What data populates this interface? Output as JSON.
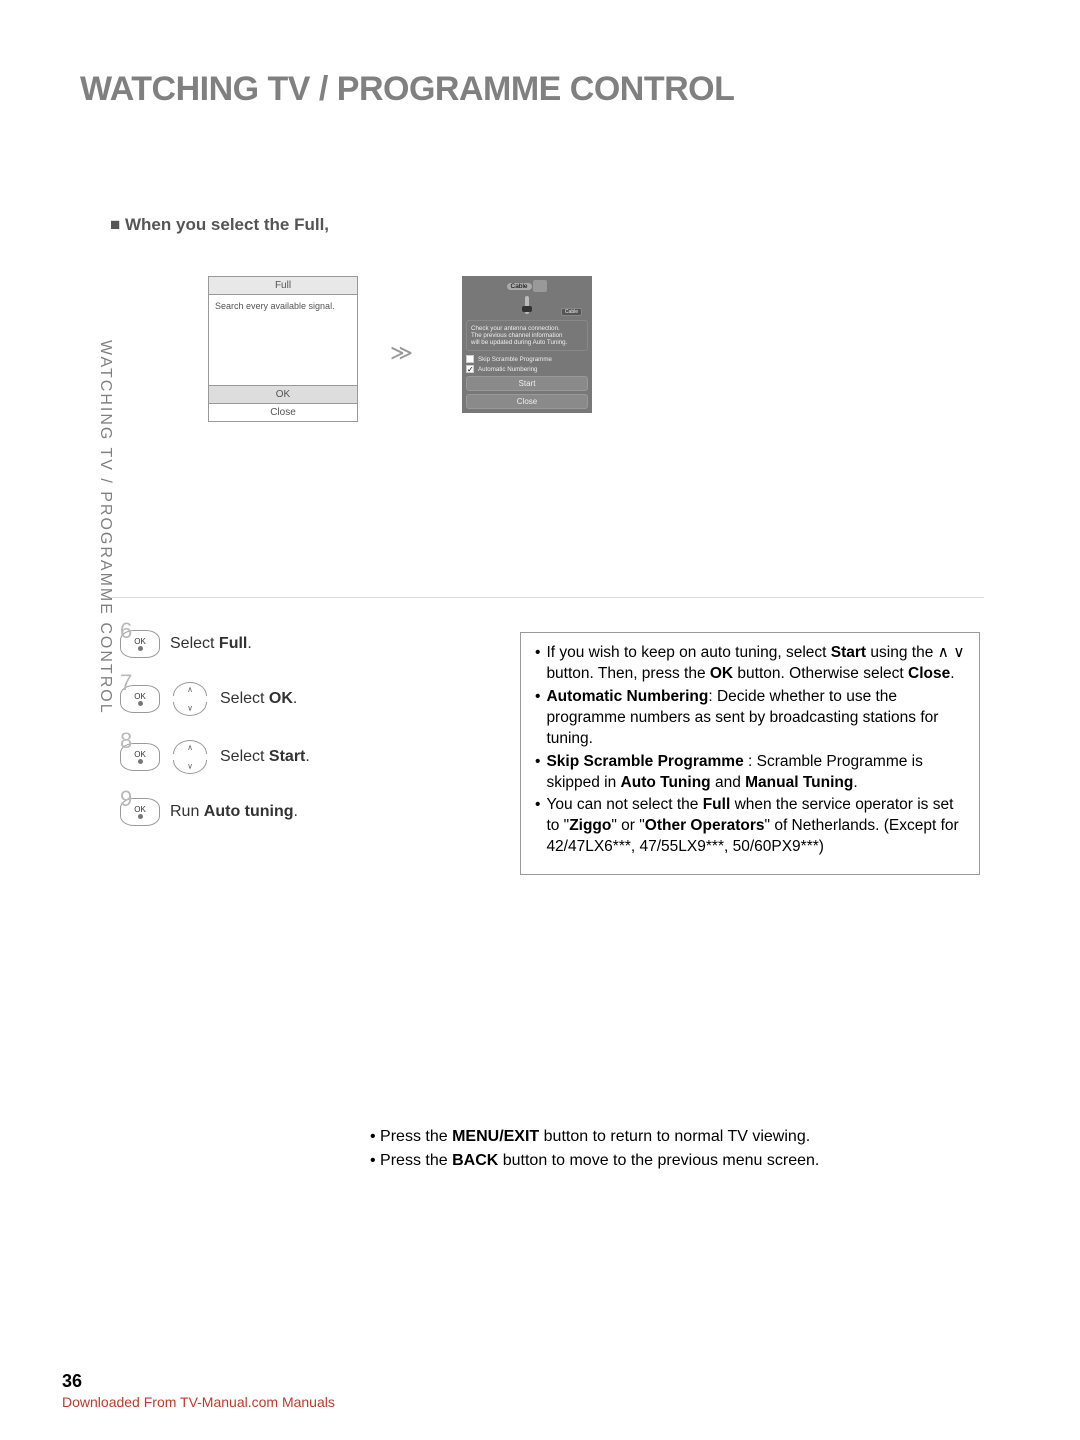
{
  "page": {
    "title": "WATCHING TV / PROGRAMME CONTROL",
    "section_heading": "■ When you select the Full,",
    "sidebar_text": "WATCHING TV / PROGRAMME CONTROL",
    "page_number": "36",
    "download_link": "Downloaded From TV-Manual.com Manuals"
  },
  "panel1": {
    "title": "Full",
    "description": "Search every available signal.",
    "ok_label": "OK",
    "close_label": "Close"
  },
  "chevron": "≫",
  "panel2": {
    "header_label": "Cable",
    "right_tag": "Cable",
    "message_l1": "Check your antenna connection.",
    "message_l2": "The previous channel information",
    "message_l3": "will be updated during Auto Tuning.",
    "check1_label": "Skip Scramble Programme",
    "check2_label": "Automatic Numbering",
    "start_label": "Start",
    "close_label": "Close"
  },
  "steps": {
    "s6": {
      "num": "6",
      "text_pre": "Select ",
      "bold": "Full",
      "text_post": "."
    },
    "s7": {
      "num": "7",
      "text_pre": "Select ",
      "bold": "OK",
      "text_post": "."
    },
    "s8": {
      "num": "8",
      "text_pre": "Select ",
      "bold": "Start",
      "text_post": "."
    },
    "s9": {
      "num": "9",
      "text_pre": "Run ",
      "bold": "Auto tuning",
      "text_post": "."
    },
    "ok_label": "OK"
  },
  "info": {
    "b1a": "If you wish to keep on auto tuning, select ",
    "b1b": "Start",
    "b1c": " using the ∧ ∨ button. Then, press the ",
    "b1d": "OK",
    "b1e": " button. Otherwise select ",
    "b1f": "Close",
    "b1g": ".",
    "b2a": "Automatic Numbering",
    "b2b": ": Decide whether to use the programme numbers as sent by broadcasting stations for tuning.",
    "b3a": "Skip Scramble Programme",
    "b3b": " : Scramble Programme is skipped in ",
    "b3c": "Auto Tuning",
    "b3d": " and ",
    "b3e": "Manual Tuning",
    "b3f": ".",
    "b4a": "You can not select the ",
    "b4b": "Full",
    "b4c": " when the service operator is set to \"",
    "b4d": "Ziggo",
    "b4e": "\" or \"",
    "b4f": "Other Operators",
    "b4g": "\" of Netherlands. (Except for 42/47LX6***, 47/55LX9***, 50/60PX9***)"
  },
  "footer": {
    "n1a": "Press the ",
    "n1b": "MENU/EXIT",
    "n1c": " button to return to normal TV viewing.",
    "n2a": "Press the ",
    "n2b": "BACK",
    "n2c": " button to move to the previous menu screen."
  }
}
